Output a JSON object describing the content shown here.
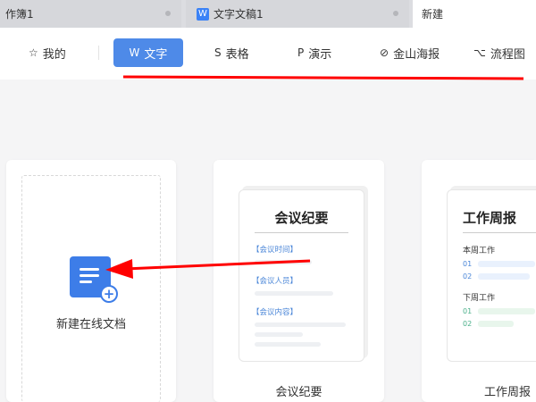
{
  "tabs": [
    {
      "label": "作簿1"
    },
    {
      "label": "文字文稿1",
      "icon": "W"
    },
    {
      "label": "新建"
    }
  ],
  "nav": {
    "items": [
      {
        "label": "我的",
        "icon": "☆"
      },
      {
        "label": "文字",
        "icon": "W"
      },
      {
        "label": "表格",
        "icon": "S"
      },
      {
        "label": "演示",
        "icon": "P"
      },
      {
        "label": "金山海报",
        "icon": "⊘"
      },
      {
        "label": "流程图",
        "icon": "⌥"
      }
    ]
  },
  "cards": {
    "new_doc": {
      "label": "新建在线文档"
    },
    "meeting": {
      "label": "会议纪要",
      "title": "会议纪要",
      "sections": [
        "【会议时间】",
        "【会议人员】",
        "【会议内容】"
      ]
    },
    "weekly": {
      "label": "工作周报",
      "title": "工作周报",
      "this_week": "本周工作",
      "next_week": "下周工作",
      "nums": [
        "01",
        "02"
      ]
    }
  },
  "colors": {
    "accent": "#4e8ae8",
    "annotation": "#ff0000"
  }
}
